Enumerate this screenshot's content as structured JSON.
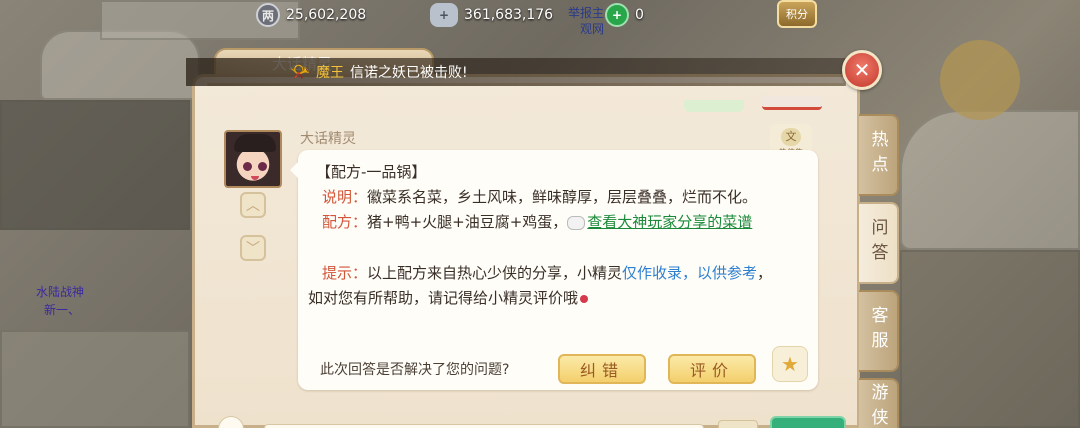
{
  "resources": {
    "silver": "25,602,208",
    "gold": "361,683,176",
    "jade": "0",
    "points_label": "积分",
    "tiny_label_1": "举报主",
    "tiny_label_2": "观网"
  },
  "notice": {
    "highlight": "魔王",
    "text": "信诺之妖已被击败!"
  },
  "window": {
    "tab_title": "大话精灵"
  },
  "side_labels": {
    "line1": "水陆战神",
    "line2": "新一、"
  },
  "tabs": [
    {
      "label": "热点"
    },
    {
      "label": "问答"
    },
    {
      "label": "客服"
    },
    {
      "label": "游侠"
    }
  ],
  "message": {
    "sender": "大话精灵",
    "title": "【配方-一品锅】",
    "desc_label": "说明：",
    "desc_text": "徽菜系名菜，乡土风味，鲜味醇厚，层层叠叠，烂而不化。",
    "recipe_label": "配方：",
    "recipe_text": "猪+鸭+火腿+油豆腐+鸡蛋，",
    "recipe_link": "查看大神玩家分享的菜谱",
    "tip_label": "提示：",
    "tip_text": "以上配方来自热心少侠的分享，小精灵",
    "tip_blue": "仅作收录，以供参考",
    "tip_end": "，",
    "tip_line2": "如对您有所帮助，请记得给小精灵评价哦"
  },
  "feedback": {
    "question": "此次回答是否解决了您的问题?",
    "correct_label": "纠错",
    "rate_label": "评价"
  },
  "badge": {
    "label": "热侠集"
  },
  "colors": {
    "label_red": "#d2553a",
    "link_green": "#1a8a3a",
    "blue_text": "#2d7fd0",
    "panel_bg": "#f3e9d9"
  }
}
